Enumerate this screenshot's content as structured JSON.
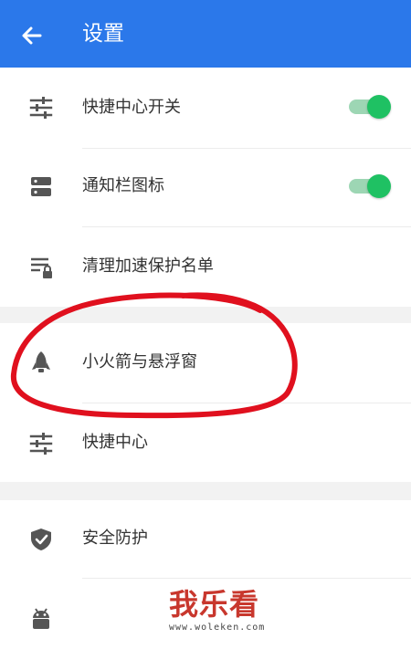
{
  "appbar": {
    "title": "设置",
    "back_icon": "arrow-left-icon",
    "color": "#2b78ea"
  },
  "items": [
    {
      "label": "快捷中心开关",
      "icon": "sliders-icon",
      "toggle": true,
      "toggle_on": true
    },
    {
      "label": "通知栏图标",
      "icon": "notification-bar-icon",
      "toggle": true,
      "toggle_on": true
    },
    {
      "label": "清理加速保护名单",
      "icon": "list-lock-icon",
      "toggle": false
    },
    {
      "label": "小火箭与悬浮窗",
      "icon": "rocket-icon",
      "toggle": false
    },
    {
      "label": "快捷中心",
      "icon": "sliders-icon",
      "toggle": false
    },
    {
      "label": "安全防护",
      "icon": "shield-check-icon",
      "toggle": false
    },
    {
      "label": "",
      "icon": "android-icon",
      "toggle": false
    }
  ],
  "annotation": {
    "shape": "hand-drawn-circle",
    "color": "#e0101e"
  },
  "watermark": {
    "text": "我乐看",
    "url": "www.woleken.com"
  },
  "colors": {
    "toggle_on": "#1fc163",
    "toggle_track": "#9dd6b4",
    "icon": "#555555"
  }
}
